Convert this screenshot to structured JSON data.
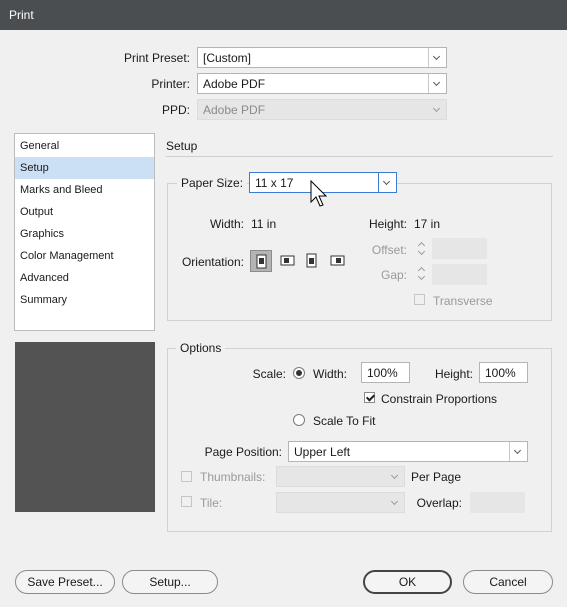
{
  "window": {
    "title": "Print"
  },
  "print_preset": {
    "label": "Print Preset:",
    "value": "[Custom]"
  },
  "printer": {
    "label": "Printer:",
    "value": "Adobe PDF"
  },
  "ppd": {
    "label": "PPD:",
    "value": "Adobe PDF"
  },
  "sidebar": {
    "selected": "Setup",
    "items": [
      {
        "label": "General"
      },
      {
        "label": "Setup"
      },
      {
        "label": "Marks and Bleed"
      },
      {
        "label": "Output"
      },
      {
        "label": "Graphics"
      },
      {
        "label": "Color Management"
      },
      {
        "label": "Advanced"
      },
      {
        "label": "Summary"
      }
    ]
  },
  "setup": {
    "title": "Setup",
    "paper_size": {
      "label": "Paper Size:",
      "value": "11 x 17"
    },
    "width": {
      "label": "Width:",
      "value": "11 in"
    },
    "height": {
      "label": "Height:",
      "value": "17 in"
    },
    "orientation": {
      "label": "Orientation:",
      "selected_index": 0,
      "icons": [
        "portrait-orientation-icon",
        "landscape-orientation-icon",
        "reverse-portrait-orientation-icon",
        "reverse-landscape-orientation-icon"
      ]
    },
    "offset": {
      "label": "Offset:",
      "value": ""
    },
    "gap": {
      "label": "Gap:",
      "value": ""
    },
    "transverse": {
      "label": "Transverse",
      "checked": false,
      "enabled": false
    }
  },
  "options": {
    "title": "Options",
    "scale": {
      "label": "Scale:"
    },
    "scale_width": {
      "label": "Width:",
      "value": "100%",
      "selected": true
    },
    "scale_height": {
      "label": "Height:",
      "value": "100%"
    },
    "constrain": {
      "label": "Constrain Proportions",
      "checked": true
    },
    "scale_to_fit": {
      "label": "Scale To Fit",
      "selected": false
    },
    "page_position": {
      "label": "Page Position:",
      "value": "Upper Left"
    },
    "thumbnails": {
      "label": "Thumbnails:",
      "value": "",
      "suffix": "Per Page",
      "enabled": false
    },
    "tile": {
      "label": "Tile:",
      "value": "",
      "overlap_label": "Overlap:",
      "enabled": false
    }
  },
  "buttons": {
    "save_preset": "Save Preset...",
    "setup": "Setup...",
    "ok": "OK",
    "cancel": "Cancel"
  },
  "colors": {
    "titlebar": "#4a4e51",
    "selection": "#cce0f5",
    "preview": "#535353",
    "focus": "#3a7bd5"
  }
}
